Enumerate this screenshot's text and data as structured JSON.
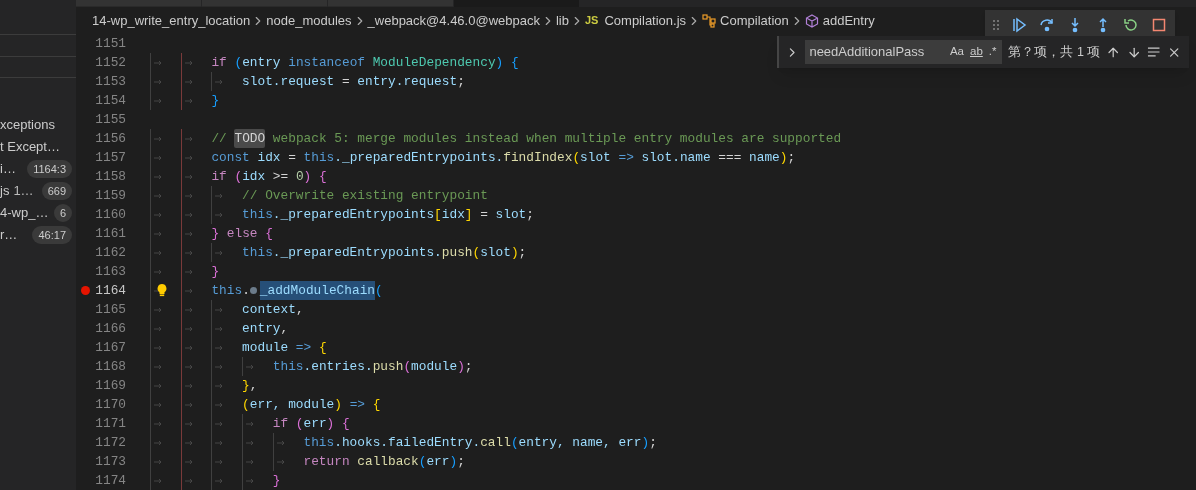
{
  "tabs": [
    {
      "selected": false
    },
    {
      "selected": false
    },
    {
      "selected": false
    },
    {
      "selected": true
    }
  ],
  "sidebar": {
    "items": [
      {
        "label": "xceptions"
      },
      {
        "label": "t Except…"
      },
      {
        "label": "i…",
        "badge": "1164:3"
      },
      {
        "label": "js",
        "detail": "1…",
        "badge": "669"
      },
      {
        "label": "4-wp_…",
        "badge": "6"
      },
      {
        "label": "r…",
        "badge": "46:17"
      }
    ]
  },
  "breadcrumb": [
    {
      "kind": "folder",
      "label": "14-wp_write_entry_location"
    },
    {
      "kind": "folder",
      "label": "node_modules"
    },
    {
      "kind": "folder",
      "label": "_webpack@4.46.0@webpack"
    },
    {
      "kind": "folder",
      "label": "lib"
    },
    {
      "kind": "file",
      "badge": "JS",
      "label": "Compilation.js"
    },
    {
      "kind": "class",
      "label": "Compilation"
    },
    {
      "kind": "method",
      "label": "addEntry"
    }
  ],
  "debug_toolbar": [
    {
      "kind": "continue"
    },
    {
      "kind": "step-over"
    },
    {
      "kind": "step-into"
    },
    {
      "kind": "step-out"
    },
    {
      "kind": "restart"
    },
    {
      "kind": "stop"
    }
  ],
  "find": {
    "value": "needAdditionalPass",
    "options": [
      {
        "label": "Aa",
        "on": false
      },
      {
        "label": "ab",
        "on": false
      },
      {
        "label": ".*",
        "on": false
      }
    ],
    "result": "第？项，共 1 项"
  },
  "lines": [
    {
      "number": "1151",
      "breakpoint": false,
      "lightbulb": false
    },
    {
      "number": "1152",
      "breakpoint": false,
      "lightbulb": false,
      "tokens": [
        {
          "kind": "ctl",
          "text": "if"
        },
        {
          "kind": "b3",
          "text": " ("
        },
        {
          "kind": "v",
          "text": "entry"
        },
        {
          "kind": "kw",
          "text": " instanceof"
        },
        {
          "kind": "cls",
          "text": " ModuleDependency"
        },
        {
          "kind": "b3",
          "text": ")"
        },
        {
          "kind": "b3",
          "text": " {"
        }
      ],
      "children": [
        {
          "number": "1153",
          "breakpoint": false,
          "lightbulb": false,
          "tokens": [
            {
              "kind": "v",
              "text": "slot.request"
            },
            {
              "kind": "p",
              "text": " = "
            },
            {
              "kind": "v",
              "text": "entry.request"
            },
            {
              "kind": "p",
              "text": ";"
            }
          ]
        }
      ]
    },
    {
      "number": "1154",
      "breakpoint": false,
      "lightbulb": false,
      "tokens": [
        {
          "kind": "b3",
          "text": "}"
        }
      ]
    },
    {
      "number": "1155",
      "breakpoint": false,
      "lightbulb": false
    },
    {
      "number": "1156",
      "breakpoint": false,
      "lightbulb": false,
      "tokens": [
        {
          "kind": "c",
          "text": "// "
        },
        {
          "kind": "todo",
          "text": "TODO"
        },
        {
          "kind": "c",
          "text": " webpack 5: merge modules instead when multiple entry modules are supported"
        }
      ]
    },
    {
      "number": "1157",
      "breakpoint": false,
      "lightbulb": false,
      "tokens": [
        {
          "kind": "kw",
          "text": "const"
        },
        {
          "kind": "v",
          "text": " idx"
        },
        {
          "kind": "p",
          "text": " = "
        },
        {
          "kind": "kw",
          "text": "this"
        },
        {
          "kind": "v",
          "text": "._preparedEntrypoints."
        },
        {
          "kind": "fn",
          "text": "findIndex"
        },
        {
          "kind": "b1",
          "text": "("
        },
        {
          "kind": "v",
          "text": "slot"
        },
        {
          "kind": "kw",
          "text": " => "
        },
        {
          "kind": "v",
          "text": "slot.name"
        },
        {
          "kind": "p",
          "text": " === "
        },
        {
          "kind": "v",
          "text": "name"
        },
        {
          "kind": "b1",
          "text": ")"
        },
        {
          "kind": "p",
          "text": ";"
        }
      ]
    },
    {
      "number": "1158",
      "breakpoint": false,
      "lightbulb": false,
      "tokens": [
        {
          "kind": "ctl",
          "text": "if"
        },
        {
          "kind": "b2",
          "text": " ("
        },
        {
          "kind": "v",
          "text": "idx"
        },
        {
          "kind": "p",
          "text": " >= "
        },
        {
          "kind": "n",
          "text": "0"
        },
        {
          "kind": "b2",
          "text": ")"
        },
        {
          "kind": "b2",
          "text": " {"
        }
      ],
      "children": [
        {
          "number": "1159",
          "breakpoint": false,
          "lightbulb": false,
          "tokens": [
            {
              "kind": "c",
              "text": "// Overwrite existing entrypoint"
            }
          ]
        },
        {
          "number": "1160",
          "breakpoint": false,
          "lightbulb": false,
          "tokens": [
            {
              "kind": "kw",
              "text": "this"
            },
            {
              "kind": "v",
              "text": "._preparedEntrypoints"
            },
            {
              "kind": "b1",
              "text": "["
            },
            {
              "kind": "v",
              "text": "idx"
            },
            {
              "kind": "b1",
              "text": "]"
            },
            {
              "kind": "p",
              "text": " = "
            },
            {
              "kind": "v",
              "text": "slot"
            },
            {
              "kind": "p",
              "text": ";"
            }
          ]
        }
      ]
    },
    {
      "number": "1161",
      "breakpoint": false,
      "lightbulb": false,
      "tokens": [
        {
          "kind": "b2",
          "text": "}"
        },
        {
          "kind": "ctl",
          "text": " else"
        },
        {
          "kind": "b2",
          "text": " {"
        }
      ],
      "children": [
        {
          "number": "1162",
          "breakpoint": false,
          "lightbulb": false,
          "tokens": [
            {
              "kind": "kw",
              "text": "this"
            },
            {
              "kind": "v",
              "text": "._preparedEntrypoints."
            },
            {
              "kind": "fn",
              "text": "push"
            },
            {
              "kind": "b1",
              "text": "("
            },
            {
              "kind": "v",
              "text": "slot"
            },
            {
              "kind": "b1",
              "text": ")"
            },
            {
              "kind": "p",
              "text": ";"
            }
          ]
        }
      ]
    },
    {
      "number": "1163",
      "breakpoint": false,
      "lightbulb": false,
      "tokens": [
        {
          "kind": "b2",
          "text": "}"
        }
      ]
    },
    {
      "number": "1164",
      "breakpoint": true,
      "lightbulb": true,
      "tokens": [
        {
          "kind": "kw",
          "text": "this"
        },
        {
          "kind": "p",
          "text": "."
        },
        {
          "kind": "sel",
          "text": "_addModuleChain"
        },
        {
          "kind": "b3",
          "text": "("
        }
      ],
      "children": [
        {
          "number": "1165",
          "breakpoint": false,
          "lightbulb": false,
          "tokens": [
            {
              "kind": "v",
              "text": "context"
            },
            {
              "kind": "p",
              "text": ","
            }
          ]
        },
        {
          "number": "1166",
          "breakpoint": false,
          "lightbulb": false,
          "tokens": [
            {
              "kind": "v",
              "text": "entry"
            },
            {
              "kind": "p",
              "text": ","
            }
          ]
        },
        {
          "number": "1167",
          "breakpoint": false,
          "lightbulb": false,
          "tokens": [
            {
              "kind": "v",
              "text": "module"
            },
            {
              "kind": "kw",
              "text": " =>"
            },
            {
              "kind": "b1",
              "text": " {"
            }
          ],
          "children": [
            {
              "number": "1168",
              "breakpoint": false,
              "lightbulb": false,
              "tokens": [
                {
                  "kind": "kw",
                  "text": "this"
                },
                {
                  "kind": "v",
                  "text": ".entries."
                },
                {
                  "kind": "fn",
                  "text": "push"
                },
                {
                  "kind": "b2",
                  "text": "("
                },
                {
                  "kind": "v",
                  "text": "module"
                },
                {
                  "kind": "b2",
                  "text": ")"
                },
                {
                  "kind": "p",
                  "text": ";"
                }
              ]
            }
          ]
        },
        {
          "number": "1169",
          "breakpoint": false,
          "lightbulb": false,
          "tokens": [
            {
              "kind": "b1",
              "text": "}"
            },
            {
              "kind": "p",
              "text": ","
            }
          ]
        },
        {
          "number": "1170",
          "breakpoint": false,
          "lightbulb": false,
          "tokens": [
            {
              "kind": "b1",
              "text": "("
            },
            {
              "kind": "v",
              "text": "err, module"
            },
            {
              "kind": "b1",
              "text": ")"
            },
            {
              "kind": "kw",
              "text": " =>"
            },
            {
              "kind": "b1",
              "text": " {"
            }
          ],
          "children": [
            {
              "number": "1171",
              "breakpoint": false,
              "lightbulb": false,
              "tokens": [
                {
                  "kind": "ctl",
                  "text": "if"
                },
                {
                  "kind": "b2",
                  "text": " ("
                },
                {
                  "kind": "v",
                  "text": "err"
                },
                {
                  "kind": "b2",
                  "text": ")"
                },
                {
                  "kind": "b2",
                  "text": " {"
                }
              ],
              "children": [
                {
                  "number": "1172",
                  "breakpoint": false,
                  "lightbulb": false,
                  "tokens": [
                    {
                      "kind": "kw",
                      "text": "this"
                    },
                    {
                      "kind": "v",
                      "text": ".hooks.failedEntry."
                    },
                    {
                      "kind": "fn",
                      "text": "call"
                    },
                    {
                      "kind": "b3",
                      "text": "("
                    },
                    {
                      "kind": "v",
                      "text": "entry, name, err"
                    },
                    {
                      "kind": "b3",
                      "text": ")"
                    },
                    {
                      "kind": "p",
                      "text": ";"
                    }
                  ]
                },
                {
                  "number": "1173",
                  "breakpoint": false,
                  "lightbulb": false,
                  "tokens": [
                    {
                      "kind": "ctl",
                      "text": "return"
                    },
                    {
                      "kind": "fn",
                      "text": " callback"
                    },
                    {
                      "kind": "b3",
                      "text": "("
                    },
                    {
                      "kind": "v",
                      "text": "err"
                    },
                    {
                      "kind": "b3",
                      "text": ")"
                    },
                    {
                      "kind": "p",
                      "text": ";"
                    }
                  ]
                }
              ]
            },
            {
              "number": "1174",
              "breakpoint": false,
              "lightbulb": false,
              "tokens": [
                {
                  "kind": "b2",
                  "text": "}"
                }
              ]
            }
          ]
        }
      ]
    }
  ]
}
